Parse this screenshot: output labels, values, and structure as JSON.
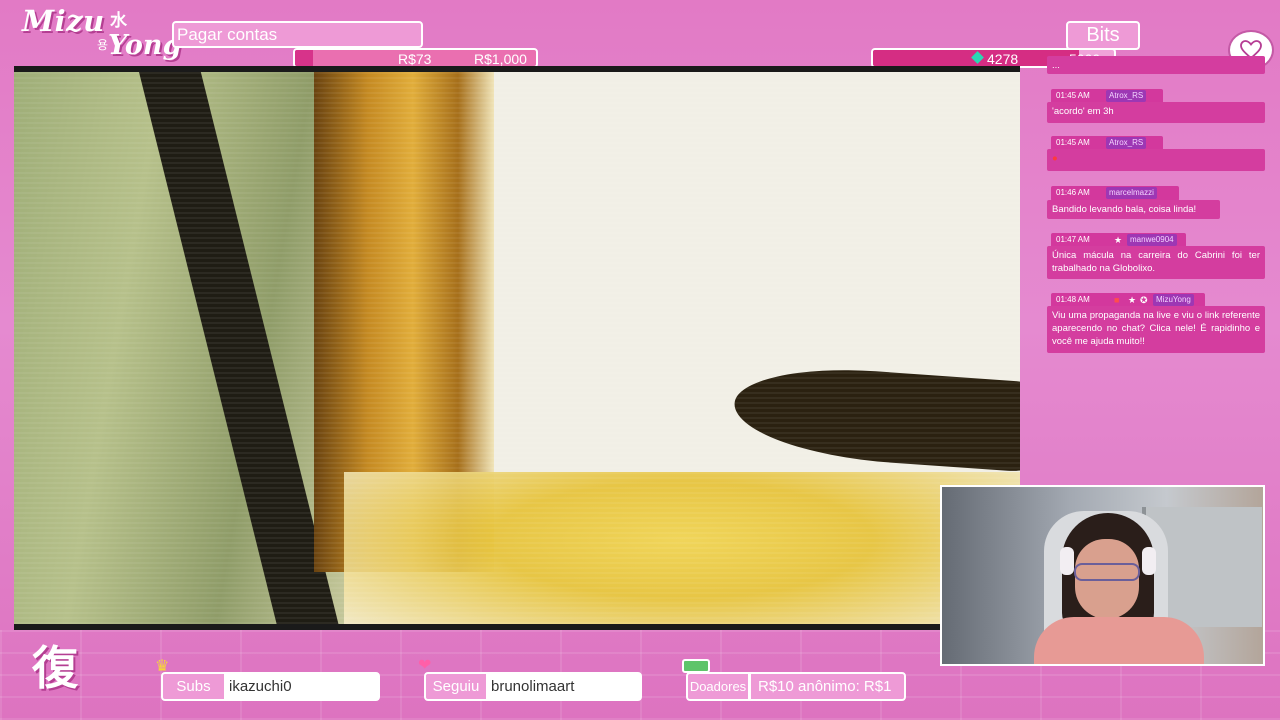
{
  "brand": {
    "logo_mizu": "Mizu",
    "logo_yong": "Yong",
    "logo_kanji": "水",
    "logo_hangul": "용",
    "fuku_kanji": "復"
  },
  "goals": {
    "money": {
      "title": "Pagar contas",
      "current": "R$73",
      "target": "R$1,000",
      "progress_fraction": 0.073
    },
    "bits": {
      "title": "Bits",
      "current": "4278",
      "target": "5000",
      "progress_fraction": 0.8556
    }
  },
  "chat": {
    "partial_top": "...",
    "messages": [
      {
        "time": "01:45 AM",
        "user": "Atrox_RS",
        "text": "'acordo' em 3h"
      },
      {
        "time": "01:45 AM",
        "user": "Atrox_RS",
        "text": "●"
      },
      {
        "time": "01:46 AM",
        "user": "marcelmazzi",
        "text": "Bandido levando bala, coisa linda!"
      },
      {
        "time": "01:47 AM",
        "user": "manwe0904",
        "text": "Única mácula na carreira do Cabrini foi ter trabalhado na Globolixo."
      },
      {
        "time": "01:48 AM",
        "user": "MizuYong",
        "text": "Viu uma propaganda na live e viu o link referente aparecendo no chat? Clica nele! É rapidinho e você me ajuda muito!!"
      }
    ]
  },
  "bottom": {
    "subs_label": "Subs",
    "subs_value": "ikazuchi0",
    "follow_label": "Seguiu",
    "follow_value": "brunolimaart",
    "donors_label": "Doadores",
    "donors_value": "R$10    anônimo: R$1"
  },
  "colors": {
    "background": "#e27ac5",
    "accent": "#d3389d",
    "username_badge": "#9d37b4"
  },
  "icons": {
    "crown": "crown-icon",
    "heart": "heart-icon",
    "money": "money-icon",
    "chat_heart": "heart-bubble-icon",
    "gem": "gem-icon"
  }
}
